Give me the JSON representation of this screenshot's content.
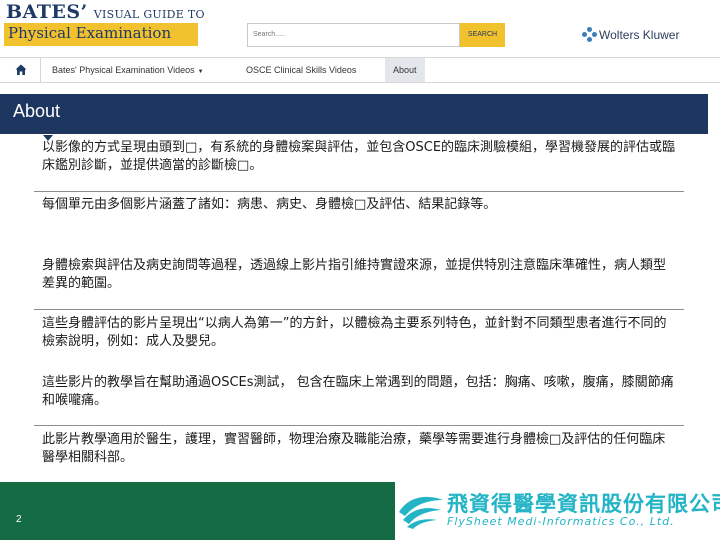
{
  "header": {
    "brand": "BATES’",
    "subtitle": "VISUAL GUIDE TO",
    "product": "Physical Examination",
    "search": {
      "placeholder": "Search.....",
      "button_label": "SEARCH"
    },
    "publisher": "Wolters Kluwer"
  },
  "nav": {
    "home_icon": "home-icon",
    "items": [
      {
        "label": "Bates' Physical Examination Videos",
        "has_dropdown": true,
        "active": false
      },
      {
        "label": "OSCE Clinical Skills Videos",
        "has_dropdown": false,
        "active": false
      },
      {
        "label": "About",
        "has_dropdown": false,
        "active": true
      }
    ]
  },
  "section": {
    "title": "About"
  },
  "paragraphs": [
    "以影像的方式呈現由頭到□，有系統的身體檢案與評估，並包含OSCE的臨床測驗模組，學習機發展的評估或臨床鑑別診斷，並提供適當的診斷檢□。",
    "每個單元由多個影片涵蓋了諸如：病患、病史、身體檢□及評估、結果記錄等。",
    "身體檢索與評估及病史詢問等過程，透過線上影片指引維持實證來源，並提供特別注意臨床準確性，病人類型差異的範圍。",
    "這些身體評估的影片呈現出“以病人為第一”的方針，以體檢為主要系列特色，並針對不同類型患者進行不同的檢索說明，例如：成人及嬰兒。",
    "這些影片的教學旨在幫助通過OSCEs測試， 包含在臨床上常遇到的問題，包括：胸痛、咳嗽，腹痛，膝關節痛和喉嚨痛。",
    "此影片教學適用於醫生，護理，實習醫師，物理治療及職能治療，藥學等需要進行身體檢□及評估的任何臨床醫學相關科部。"
  ],
  "footer": {
    "page_number": "2",
    "company_cn": "飛資得醫學資訊股份有限公司",
    "company_en": "FlySheet Medi-Informatics Co., Ltd."
  },
  "colors": {
    "navy": "#1c3660",
    "gold": "#f2c12e",
    "footer_green": "#156b44",
    "flysheet_teal": "#23b4c6",
    "wk_blue": "#3a7fb8"
  }
}
